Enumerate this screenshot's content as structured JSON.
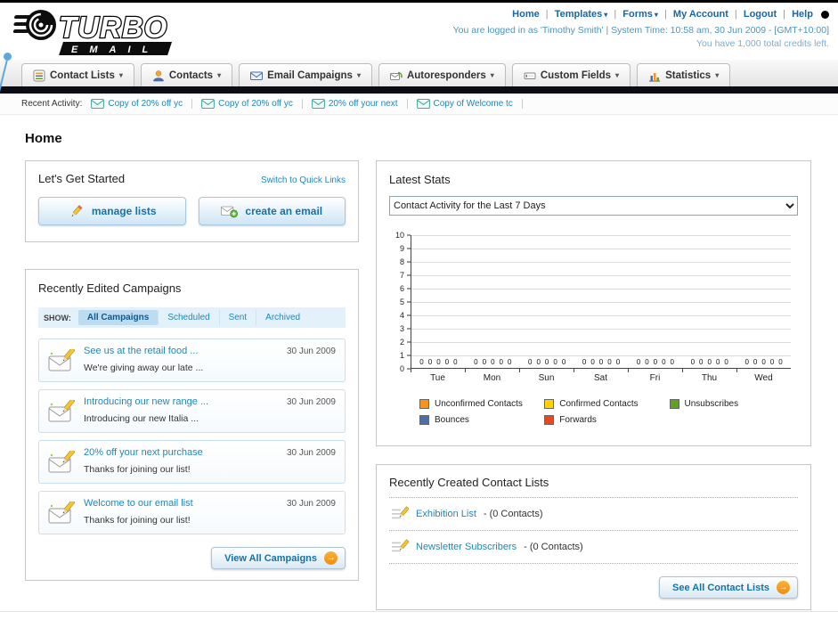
{
  "header": {
    "logo_title": "TURBO",
    "logo_subtitle": "EMAIL",
    "nav": [
      {
        "label": "Home",
        "dropdown": false
      },
      {
        "label": "Templates",
        "dropdown": true
      },
      {
        "label": "Forms",
        "dropdown": true
      },
      {
        "label": "My Account",
        "dropdown": false
      },
      {
        "label": "Logout",
        "dropdown": false
      },
      {
        "label": "Help",
        "dropdown": false
      }
    ],
    "login_info": "You are logged in as 'Timothy Smith' | System Time: 10:58 am, 30 Jun 2009 - [GMT+10:00]",
    "credits_info": "You have 1,000 total credits left."
  },
  "main_nav": {
    "tabs": [
      {
        "label": "Contact Lists"
      },
      {
        "label": "Contacts"
      },
      {
        "label": "Email Campaigns"
      },
      {
        "label": "Autoresponders"
      },
      {
        "label": "Custom Fields"
      },
      {
        "label": "Statistics"
      }
    ]
  },
  "recent_activity": {
    "label": "Recent Activity:",
    "items": [
      {
        "label": "Copy of 20% off yc"
      },
      {
        "label": "Copy of 20% off yc"
      },
      {
        "label": "20% off your next"
      },
      {
        "label": "Copy of Welcome tc"
      }
    ]
  },
  "page": {
    "title": "Home"
  },
  "get_started": {
    "title": "Let's Get Started",
    "switch_link": "Switch to Quick Links",
    "manage_lists_button": "manage lists",
    "create_email_button": "create an email"
  },
  "campaigns": {
    "title": "Recently Edited Campaigns",
    "show_label": "SHOW:",
    "filters": [
      {
        "label": "All Campaigns",
        "selected": true
      },
      {
        "label": "Scheduled",
        "selected": false
      },
      {
        "label": "Sent",
        "selected": false
      },
      {
        "label": "Archived",
        "selected": false
      }
    ],
    "items": [
      {
        "title": "See us at the retail food ...",
        "subtitle": "We're giving away our late ...",
        "date": "30 Jun 2009"
      },
      {
        "title": "Introducing our new range ...",
        "subtitle": "Introducing our new Italia ...",
        "date": "30 Jun 2009"
      },
      {
        "title": "20% off your next purchase",
        "subtitle": "Thanks for joining our list!",
        "date": "30 Jun 2009"
      },
      {
        "title": "Welcome to our email list",
        "subtitle": "Thanks for joining our list!",
        "date": "30 Jun 2009"
      }
    ],
    "view_all_button": "View All Campaigns"
  },
  "stats": {
    "title": "Latest Stats",
    "selected_filter": "Contact Activity for the Last 7 Days"
  },
  "chart_data": {
    "type": "bar",
    "title": "Contact Activity for the Last 7 Days",
    "categories": [
      "Tue",
      "Mon",
      "Sun",
      "Sat",
      "Fri",
      "Thu",
      "Wed"
    ],
    "series": [
      {
        "name": "Unconfirmed Contacts",
        "color": "#F7941E",
        "values": [
          0,
          0,
          0,
          0,
          0,
          0,
          0
        ]
      },
      {
        "name": "Confirmed Contacts",
        "color": "#FFD200",
        "values": [
          0,
          0,
          0,
          0,
          0,
          0,
          0
        ]
      },
      {
        "name": "Unsubscribes",
        "color": "#5DA423",
        "values": [
          0,
          0,
          0,
          0,
          0,
          0,
          0
        ]
      },
      {
        "name": "Bounces",
        "color": "#4D6FA8",
        "values": [
          0,
          0,
          0,
          0,
          0,
          0,
          0
        ]
      },
      {
        "name": "Forwards",
        "color": "#E8471F",
        "values": [
          0,
          0,
          0,
          0,
          0,
          0,
          0
        ]
      }
    ],
    "ylim": [
      0,
      10
    ],
    "yticks": [
      10,
      9,
      8,
      7,
      6,
      5,
      4,
      3,
      2,
      1,
      0
    ],
    "xlabel": "",
    "ylabel": "",
    "grid": true,
    "legend_position": "bottom"
  },
  "contact_lists": {
    "title": "Recently Created Contact Lists",
    "items": [
      {
        "name": "Exhibition List",
        "detail": "- (0 Contacts)"
      },
      {
        "name": "Newsletter Subscribers",
        "detail": "- (0 Contacts)"
      }
    ],
    "see_all_button": "See All Contact Lists"
  }
}
